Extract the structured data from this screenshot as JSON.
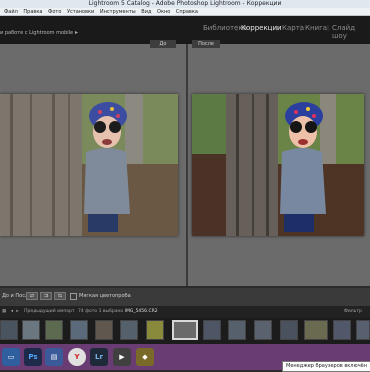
{
  "window": {
    "title": "Lightroom 5 Catalog - Adobe Photoshop Lightroom - Коррекции"
  },
  "menu": {
    "items": [
      "Файл",
      "Правка",
      "Фото",
      "Установки",
      "Инструменты",
      "Вид",
      "Окно",
      "Справка"
    ]
  },
  "header": {
    "catalog_text": "и работе с Lightroom mobile",
    "modules": [
      "Библиотека",
      "Коррекции",
      "Карта",
      "Книга",
      "Слайд шоу"
    ],
    "active_module": "Коррекции"
  },
  "compare": {
    "before_label": "До",
    "after_label": "После"
  },
  "toolbar": {
    "mode_label": "До и После",
    "sync_label": "Мягкая цветопроба"
  },
  "filmstrip_bar": {
    "source": "Предыдущий импорт",
    "count": "74 фото",
    "selected": "1 выбрано",
    "filename": "IMG_5456.CR2",
    "filter_label": "Фильтр"
  },
  "taskbar": {
    "tooltip": "Менеджер браузеров включён"
  },
  "colors": {
    "accent_taskbar": "#6a3c74",
    "panel": "#6b6b6b",
    "header": "#1a1a1a"
  }
}
